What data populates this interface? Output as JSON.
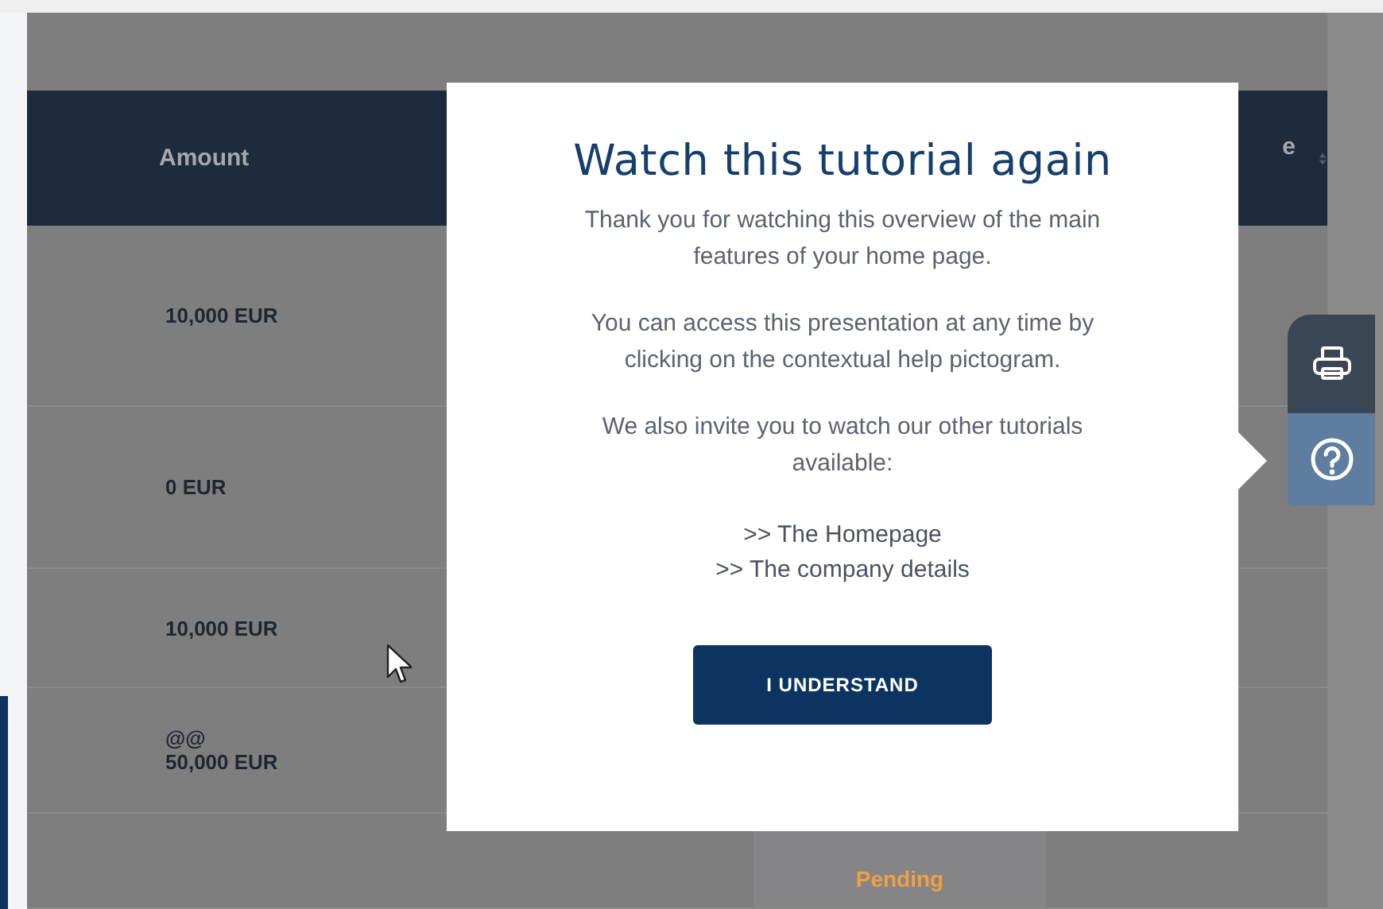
{
  "table": {
    "columns": [
      {
        "label": "Amount"
      },
      {
        "label": "e",
        "sortable": true
      }
    ],
    "rows": [
      {
        "amount": "10,000 EUR"
      },
      {
        "amount": "0 EUR"
      },
      {
        "amount": "10,000 EUR"
      },
      {
        "note": "@@",
        "amount": "50,000 EUR"
      },
      {
        "status": "Pending"
      }
    ]
  },
  "modal": {
    "title": "Watch this tutorial again",
    "paragraphs": [
      "Thank you for watching this overview of the main features of your home page.",
      "You can access this presentation at any time by clicking on the contextual help pictogram.",
      "We also invite you to watch our other tutorials available:"
    ],
    "links": [
      ">> The Homepage",
      ">> The company details"
    ],
    "button": "I UNDERSTAND"
  },
  "side_toolbar": [
    {
      "kind": "print",
      "selected": false
    },
    {
      "kind": "help",
      "selected": true
    }
  ]
}
